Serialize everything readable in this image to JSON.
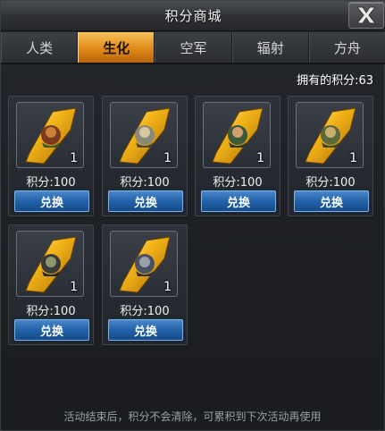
{
  "window": {
    "title": "积分商城",
    "close_icon": "close-x-icon"
  },
  "tabs": [
    {
      "label": "人类",
      "active": false
    },
    {
      "label": "生化",
      "active": true
    },
    {
      "label": "空军",
      "active": false
    },
    {
      "label": "辐射",
      "active": false
    },
    {
      "label": "方舟",
      "active": false
    }
  ],
  "points_label": "拥有的积分:63",
  "items": [
    {
      "count": "1",
      "price": "积分:100",
      "button": "兑换",
      "icon": "mutant-shard-icon"
    },
    {
      "count": "1",
      "price": "积分:100",
      "button": "兑换",
      "icon": "mutant-shard-icon"
    },
    {
      "count": "1",
      "price": "积分:100",
      "button": "兑换",
      "icon": "mutant-shard-icon"
    },
    {
      "count": "1",
      "price": "积分:100",
      "button": "兑换",
      "icon": "mutant-shard-icon"
    },
    {
      "count": "1",
      "price": "积分:100",
      "button": "兑换",
      "icon": "mutant-shard-icon"
    },
    {
      "count": "1",
      "price": "积分:100",
      "button": "兑换",
      "icon": "mutant-shard-icon"
    }
  ],
  "footer_note": "活动结束后，积分不会清除，可累积到下次活动再使用",
  "colors": {
    "tab_active": "#e08a18",
    "button": "#1f5fa6",
    "shard": "#f2b418"
  }
}
